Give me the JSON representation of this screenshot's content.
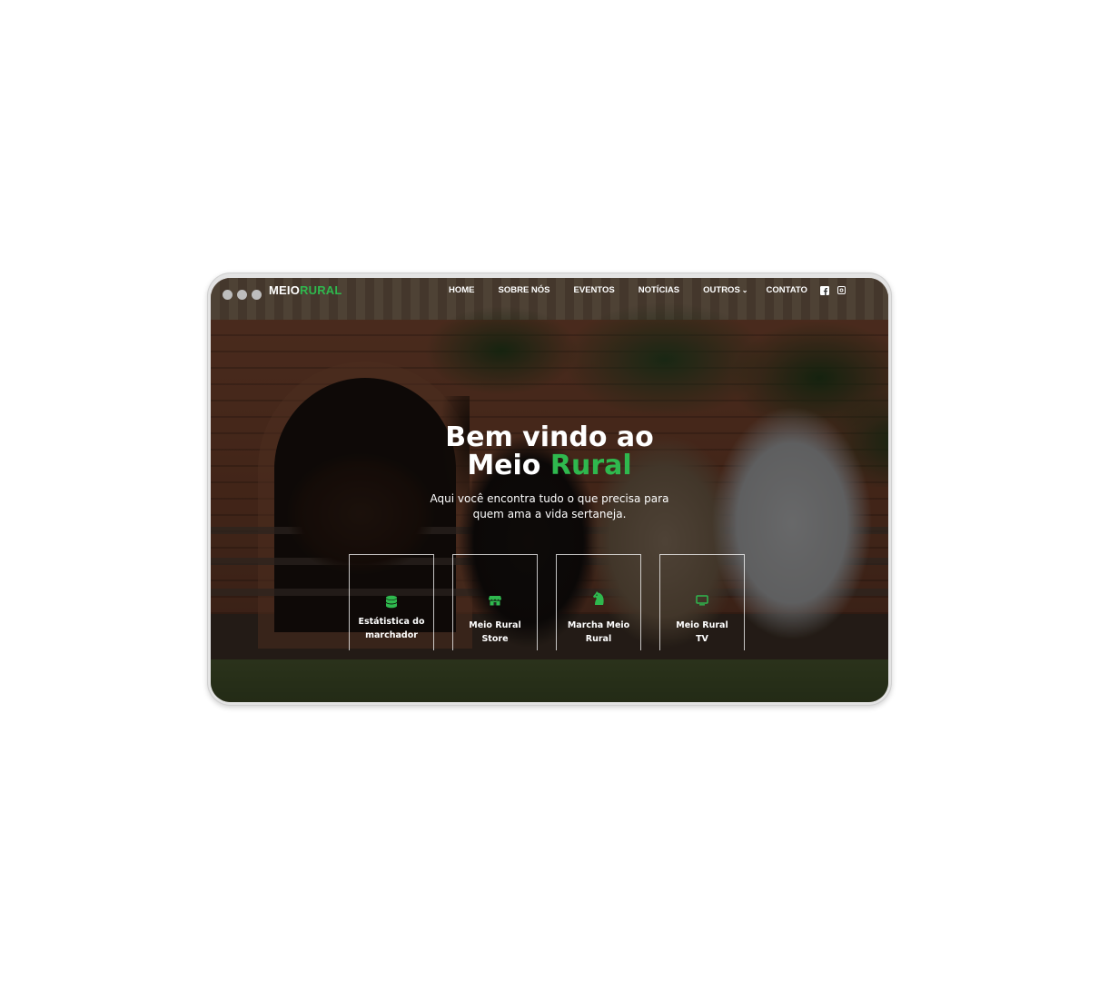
{
  "window": {
    "dots": [
      "dot-1",
      "dot-2",
      "dot-3"
    ]
  },
  "brand": {
    "logo_part1": "MEIO",
    "logo_part2": "RURAL",
    "accent_color": "#2fb84e"
  },
  "nav": {
    "items": [
      {
        "label": "HOME"
      },
      {
        "label": "SOBRE NÓS"
      },
      {
        "label": "EVENTOS"
      },
      {
        "label": "NOTÍCIAS"
      },
      {
        "label": "OUTROS"
      },
      {
        "label": "CONTATO"
      }
    ],
    "social_icons": [
      "facebook-icon",
      "instagram-icon"
    ]
  },
  "hero": {
    "title_line1": "Bem vindo ao",
    "title_line2_part1": "Meio",
    "title_line2_part2": "Rural",
    "subtitle_line1": "Aqui você encontra tudo o que precisa para",
    "subtitle_line2": "quem ama a vida sertaneja."
  },
  "cards": [
    {
      "label_line1": "Estátistica do",
      "label_line2": "marchador",
      "icon": "database-icon"
    },
    {
      "label_line1": "Meio Rural",
      "label_line2": "Store",
      "icon": "store-icon"
    },
    {
      "label_line1": "Marcha Meio",
      "label_line2": "Rural",
      "icon": "horse-head-icon"
    },
    {
      "label_line1": "Meio Rural",
      "label_line2": "TV",
      "icon": "tv-icon"
    }
  ]
}
